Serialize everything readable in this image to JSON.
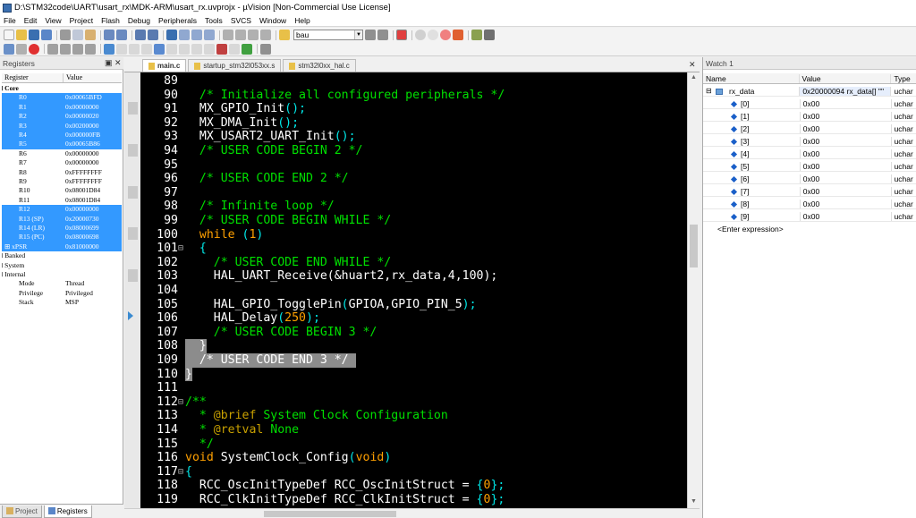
{
  "window": {
    "title": "D:\\STM32code\\UART\\usart_rx\\MDK-ARM\\usart_rx.uvprojx - µVision  [Non-Commercial Use License]"
  },
  "menu": [
    "File",
    "Edit",
    "View",
    "Project",
    "Flash",
    "Debug",
    "Peripherals",
    "Tools",
    "SVCS",
    "Window",
    "Help"
  ],
  "toolbar": {
    "search_value": "bau"
  },
  "registers": {
    "title": "Registers",
    "col_register": "Register",
    "col_value": "Value",
    "rows": [
      {
        "name": "Core",
        "value": "",
        "sel": false,
        "indent": 0,
        "toggle": "⊟",
        "bold": true
      },
      {
        "name": "R0",
        "value": "0x00065BFD",
        "sel": true,
        "indent": 2
      },
      {
        "name": "R1",
        "value": "0x00000000",
        "sel": true,
        "indent": 2
      },
      {
        "name": "R2",
        "value": "0x00000020",
        "sel": true,
        "indent": 2
      },
      {
        "name": "R3",
        "value": "0x00200000",
        "sel": true,
        "indent": 2
      },
      {
        "name": "R4",
        "value": "0x000000FB",
        "sel": true,
        "indent": 2
      },
      {
        "name": "R5",
        "value": "0x00065B86",
        "sel": true,
        "indent": 2
      },
      {
        "name": "R6",
        "value": "0x00000000",
        "sel": false,
        "indent": 2
      },
      {
        "name": "R7",
        "value": "0x00000000",
        "sel": false,
        "indent": 2
      },
      {
        "name": "R8",
        "value": "0xFFFFFFFF",
        "sel": false,
        "indent": 2
      },
      {
        "name": "R9",
        "value": "0xFFFFFFFF",
        "sel": false,
        "indent": 2
      },
      {
        "name": "R10",
        "value": "0x08001D84",
        "sel": false,
        "indent": 2
      },
      {
        "name": "R11",
        "value": "0x08001D84",
        "sel": false,
        "indent": 2
      },
      {
        "name": "R12",
        "value": "0x00000000",
        "sel": true,
        "indent": 2
      },
      {
        "name": "R13 (SP)",
        "value": "0x20000730",
        "sel": true,
        "indent": 2
      },
      {
        "name": "R14 (LR)",
        "value": "0x08000699",
        "sel": true,
        "indent": 2
      },
      {
        "name": "R15 (PC)",
        "value": "0x08000698",
        "sel": true,
        "indent": 2
      },
      {
        "name": "xPSR",
        "value": "0x81000000",
        "sel": true,
        "indent": 1,
        "toggle": "⊞"
      },
      {
        "name": "Banked",
        "value": "",
        "sel": false,
        "indent": 0,
        "toggle": "⊞"
      },
      {
        "name": "System",
        "value": "",
        "sel": false,
        "indent": 0,
        "toggle": "⊞"
      },
      {
        "name": "Internal",
        "value": "",
        "sel": false,
        "indent": 0,
        "toggle": "⊟"
      },
      {
        "name": "Mode",
        "value": "Thread",
        "sel": false,
        "indent": 2
      },
      {
        "name": "Privilege",
        "value": "Privileged",
        "sel": false,
        "indent": 2
      },
      {
        "name": "Stack",
        "value": "MSP",
        "sel": false,
        "indent": 2
      }
    ]
  },
  "bottom_tabs": {
    "project": "Project",
    "registers": "Registers"
  },
  "editor": {
    "tabs": [
      "main.c",
      "startup_stm32l053xx.s",
      "stm32l0xx_hal.c"
    ],
    "lines": [
      {
        "n": "89",
        "t": [
          [
            "",
            ""
          ]
        ]
      },
      {
        "n": "90",
        "t": [
          [
            "c-cmt",
            "  /* Initialize all configured peripherals */"
          ]
        ]
      },
      {
        "n": "91",
        "t": [
          [
            "",
            "  MX_GPIO_Init"
          ],
          [
            "c-mac",
            "();"
          ]
        ]
      },
      {
        "n": "92",
        "t": [
          [
            "",
            "  MX_DMA_Init"
          ],
          [
            "c-mac",
            "();"
          ]
        ]
      },
      {
        "n": "93",
        "t": [
          [
            "",
            "  MX_USART2_UART_Init"
          ],
          [
            "c-mac",
            "();"
          ]
        ]
      },
      {
        "n": "94",
        "t": [
          [
            "c-cmt",
            "  /* USER CODE BEGIN 2 */"
          ]
        ]
      },
      {
        "n": "95",
        "t": [
          [
            "",
            ""
          ]
        ]
      },
      {
        "n": "96",
        "t": [
          [
            "c-cmt",
            "  /* USER CODE END 2 */"
          ]
        ]
      },
      {
        "n": "97",
        "t": [
          [
            "",
            ""
          ]
        ]
      },
      {
        "n": "98",
        "t": [
          [
            "c-cmt",
            "  /* Infinite loop */"
          ]
        ]
      },
      {
        "n": "99",
        "t": [
          [
            "c-cmt",
            "  /* USER CODE BEGIN WHILE */"
          ]
        ]
      },
      {
        "n": "100",
        "t": [
          [
            "c-kw",
            "  while"
          ],
          [
            "c-mac",
            " ("
          ],
          [
            "c-num",
            "1"
          ],
          [
            "c-mac",
            ")"
          ]
        ]
      },
      {
        "n": "101",
        "f": "-",
        "t": [
          [
            "c-mac",
            "  {"
          ]
        ]
      },
      {
        "n": "102",
        "t": [
          [
            "c-cmt",
            "    /* USER CODE END WHILE */"
          ]
        ]
      },
      {
        "n": "103",
        "t": [
          [
            "",
            "    HAL_UART_Receive(&huart2,rx_data,4,100);"
          ]
        ]
      },
      {
        "n": "104",
        "t": [
          [
            "",
            ""
          ]
        ]
      },
      {
        "n": "105",
        "t": [
          [
            "",
            "    HAL_GPIO_TogglePin"
          ],
          [
            "c-mac",
            "("
          ],
          [
            "",
            "GPIOA,GPIO_PIN_5"
          ],
          [
            "c-mac",
            ");"
          ]
        ]
      },
      {
        "n": "106",
        "t": [
          [
            "",
            "    HAL_Delay"
          ],
          [
            "c-mac",
            "("
          ],
          [
            "c-num",
            "250"
          ],
          [
            "c-mac",
            ");"
          ]
        ]
      },
      {
        "n": "107",
        "t": [
          [
            "c-cmt",
            "    /* USER CODE BEGIN 3 */"
          ]
        ]
      },
      {
        "n": "108",
        "h": true,
        "t": [
          [
            "",
            "  }"
          ]
        ]
      },
      {
        "n": "109",
        "h": true,
        "t": [
          [
            "",
            "  /* USER CODE END 3 */ "
          ]
        ]
      },
      {
        "n": "110",
        "h": true,
        "t": [
          [
            "",
            "}"
          ]
        ]
      },
      {
        "n": "111",
        "t": [
          [
            "",
            ""
          ]
        ]
      },
      {
        "n": "112",
        "f": "-",
        "t": [
          [
            "c-cmt",
            "/**"
          ]
        ]
      },
      {
        "n": "113",
        "t": [
          [
            "c-cmt",
            "  * "
          ],
          [
            "c-doc",
            "@brief"
          ],
          [
            "c-cmt",
            " System Clock Configuration"
          ]
        ]
      },
      {
        "n": "114",
        "t": [
          [
            "c-cmt",
            "  * "
          ],
          [
            "c-doc",
            "@retval"
          ],
          [
            "c-cmt",
            " None"
          ]
        ]
      },
      {
        "n": "115",
        "t": [
          [
            "c-cmt",
            "  */"
          ]
        ]
      },
      {
        "n": "116",
        "t": [
          [
            "c-kw",
            "void"
          ],
          [
            "",
            " SystemClock_Config"
          ],
          [
            "c-mac",
            "("
          ],
          [
            "c-kw",
            "void"
          ],
          [
            "c-mac",
            ")"
          ]
        ]
      },
      {
        "n": "117",
        "f": "-",
        "t": [
          [
            "c-mac",
            "{"
          ]
        ]
      },
      {
        "n": "118",
        "t": [
          [
            "",
            "  RCC_OscInitTypeDef RCC_OscInitStruct = "
          ],
          [
            "c-mac",
            "{"
          ],
          [
            "c-num",
            "0"
          ],
          [
            "c-mac",
            "};"
          ]
        ]
      },
      {
        "n": "119",
        "t": [
          [
            "",
            "  RCC_ClkInitTypeDef RCC_ClkInitStruct = "
          ],
          [
            "c-mac",
            "{"
          ],
          [
            "c-num",
            "0"
          ],
          [
            "c-mac",
            "};"
          ]
        ]
      }
    ]
  },
  "watch": {
    "title": "Watch 1",
    "col_name": "Name",
    "col_value": "Value",
    "col_type": "Type",
    "rows": [
      {
        "name": "rx_data",
        "value": "0x20000094 rx_data[] \"\"",
        "type": "uchar",
        "root": true
      },
      {
        "name": "[0]",
        "value": "0x00",
        "type": "uchar"
      },
      {
        "name": "[1]",
        "value": "0x00",
        "type": "uchar"
      },
      {
        "name": "[2]",
        "value": "0x00",
        "type": "uchar"
      },
      {
        "name": "[3]",
        "value": "0x00",
        "type": "uchar"
      },
      {
        "name": "[4]",
        "value": "0x00",
        "type": "uchar"
      },
      {
        "name": "[5]",
        "value": "0x00",
        "type": "uchar"
      },
      {
        "name": "[6]",
        "value": "0x00",
        "type": "uchar"
      },
      {
        "name": "[7]",
        "value": "0x00",
        "type": "uchar"
      },
      {
        "name": "[8]",
        "value": "0x00",
        "type": "uchar"
      },
      {
        "name": "[9]",
        "value": "0x00",
        "type": "uchar"
      }
    ],
    "enter_expression": "<Enter expression>"
  },
  "colors": {
    "selection": "#3399ff",
    "code_bg": "#000000",
    "comment": "#00e000",
    "keyword": "#ffa000"
  }
}
